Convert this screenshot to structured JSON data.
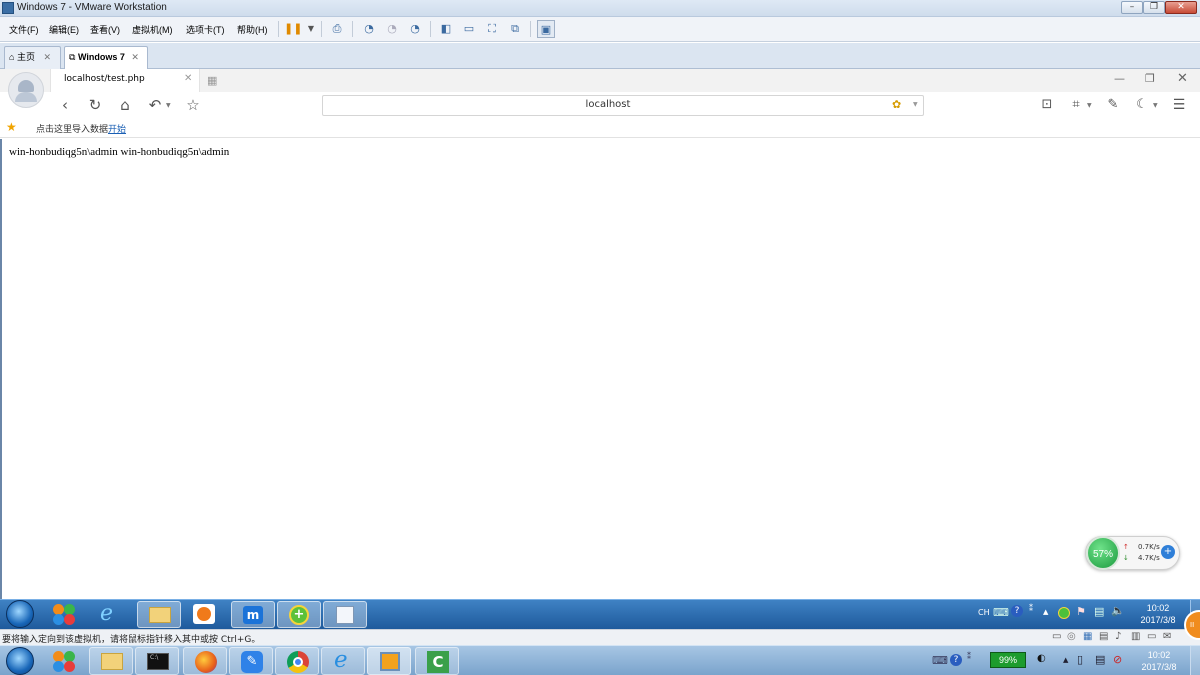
{
  "vmware": {
    "title": "Windows 7 - VMware Workstation",
    "menu": [
      "文件(F)",
      "编辑(E)",
      "查看(V)",
      "虚拟机(M)",
      "选项卡(T)",
      "帮助(H)"
    ],
    "tabs": [
      {
        "label": "主页"
      },
      {
        "label": "Windows 7"
      }
    ],
    "status_text": "要将输入定向到该虚拟机，请将鼠标指针移入其中或按 Ctrl+G。"
  },
  "browser": {
    "tab_title": "localhost/test.php",
    "address": "localhost",
    "bookmark_hint": "点击这里导入数据",
    "bookmark_link": "开始",
    "page_text": "win-honbudiqg5n\\admin win-honbudiqg5n\\admin"
  },
  "net_widget": {
    "percent": "57%",
    "up": "0.7K/s",
    "down": "4.7K/s"
  },
  "guest_taskbar": {
    "lang": "CH",
    "time": "10:02",
    "date": "2017/3/8"
  },
  "host_taskbar": {
    "battery": "99%",
    "time": "10:02",
    "date": "2017/3/8"
  },
  "colors": {
    "guest_taskbar": "#2a6cb0",
    "host_taskbar": "#8db3d8",
    "net_green": "#1a9a3d"
  }
}
